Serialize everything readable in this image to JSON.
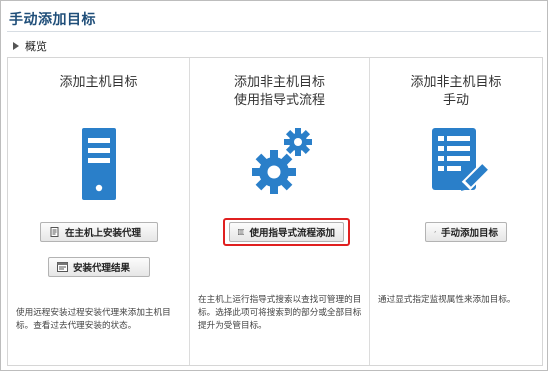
{
  "page": {
    "title": "手动添加目标"
  },
  "section": {
    "label": "概览"
  },
  "columns": [
    {
      "title_lines": [
        "添加主机目标"
      ],
      "buttons": [
        {
          "label": "在主机上安装代理",
          "icon": "document-icon"
        },
        {
          "label": "安装代理结果",
          "icon": "window-icon"
        }
      ],
      "description": "使用远程安装过程安装代理来添加主机目标。查看过去代理安装的状态。"
    },
    {
      "title_lines": [
        "添加非主机目标",
        "使用指导式流程"
      ],
      "buttons": [
        {
          "label": "使用指导式流程添加",
          "icon": "list-icon"
        }
      ],
      "description": "在主机上运行指导式搜索以查找可管理的目标。选择此项可将搜索到的部分或全部目标提升为受管目标。"
    },
    {
      "title_lines": [
        "添加非主机目标",
        "手动"
      ],
      "buttons": [
        {
          "label": "手动添加目标",
          "icon": "wrench-icon"
        }
      ],
      "description": "通过显式指定监视属性来添加目标。"
    }
  ],
  "colors": {
    "icon_blue": "#2a7fc9",
    "title_blue": "#1f4e79",
    "highlight_red": "#e02020"
  }
}
